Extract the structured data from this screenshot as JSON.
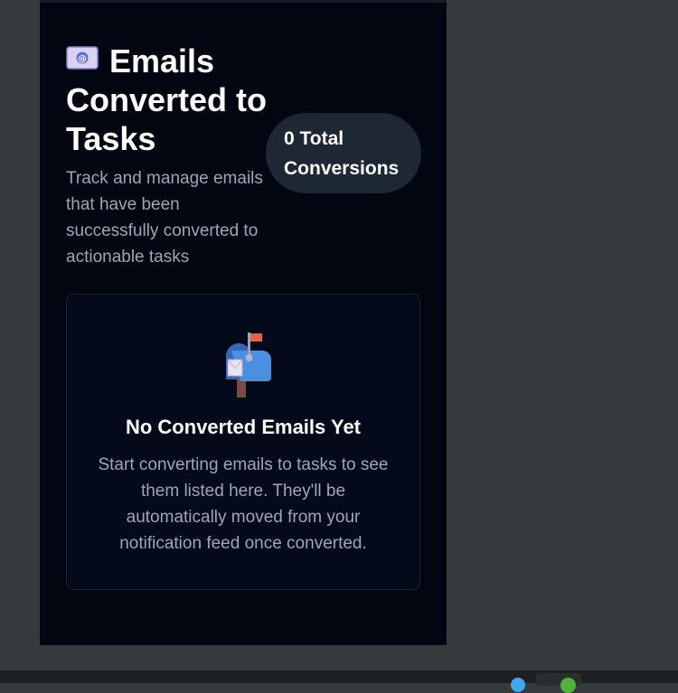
{
  "header": {
    "icon": "email-envelope-icon",
    "title": "Emails Converted to Tasks",
    "subtitle": "Track and manage emails that have been successfully converted to actionable tasks"
  },
  "stats": {
    "total_conversions_label": "0 Total Conversions"
  },
  "empty_state": {
    "icon": "mailbox-icon",
    "title": "No Converted Emails Yet",
    "description": "Start converting emails to tasks to see them listed here. They'll be automatically moved from your notification feed once converted."
  },
  "colors": {
    "panel_background": "#020611",
    "pill_background": "#1e2734",
    "muted_text": "#9ea6b5",
    "page_background": "#353b3d"
  }
}
